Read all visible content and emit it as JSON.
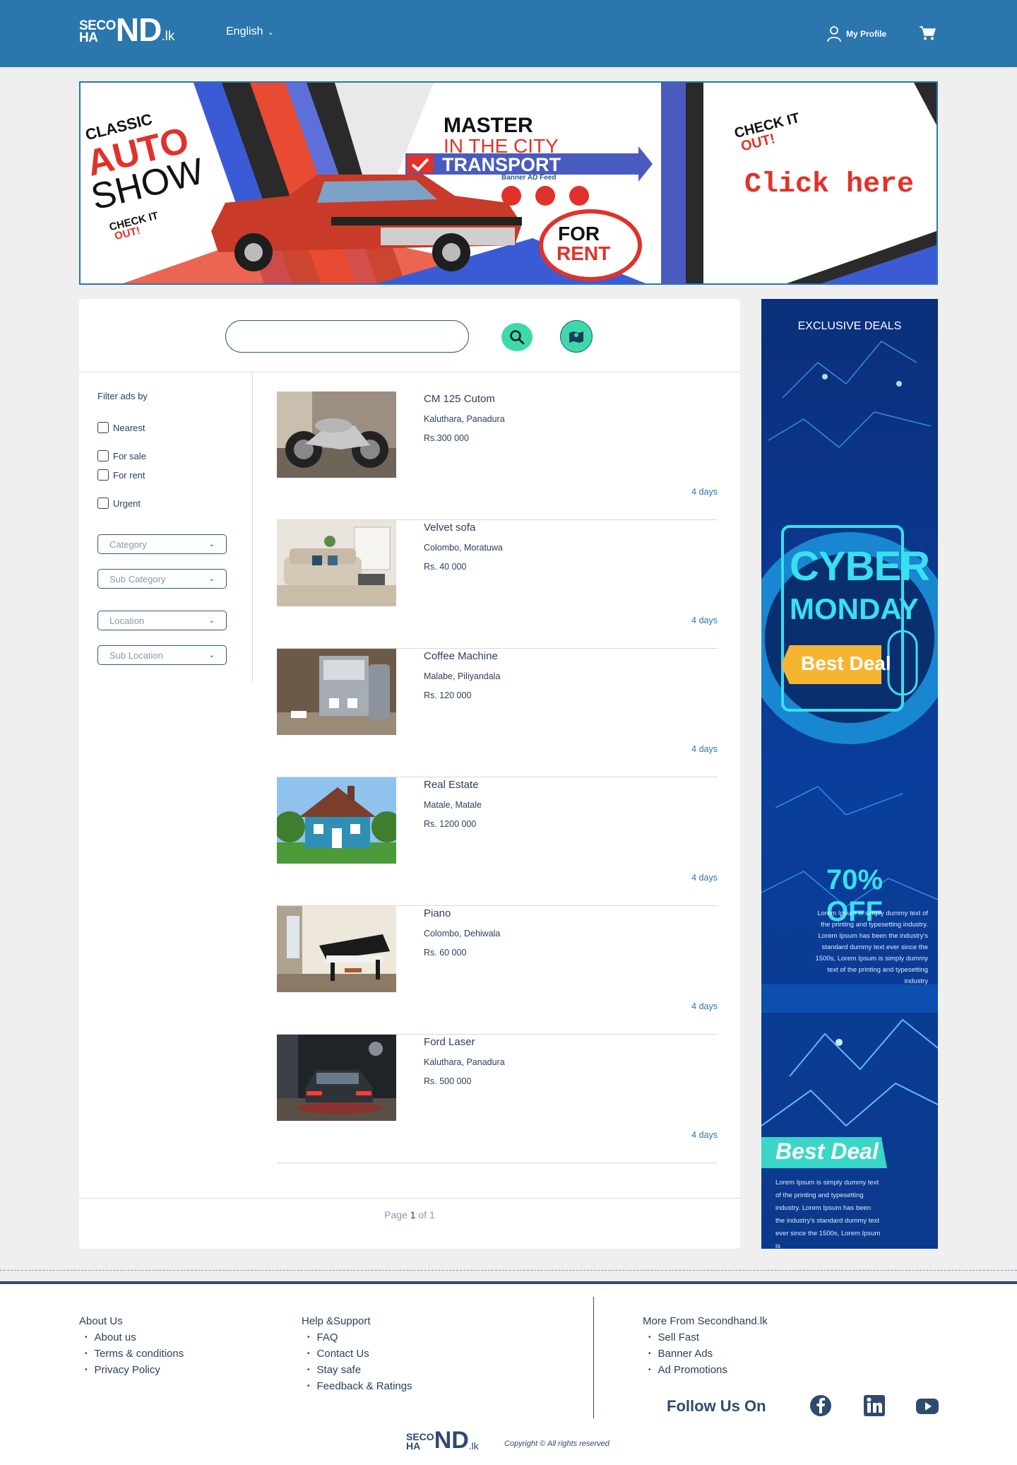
{
  "header": {
    "logo_top": "SECO",
    "logo_bottom": "HA",
    "logo_big": "ND",
    "logo_suffix": ".lk",
    "language": "English",
    "profile_label": "My Profile"
  },
  "top_banner": {
    "show_line1": "CLASSIC",
    "show_line2": "AUTO",
    "show_line3": "SHOW",
    "check_small": "CHECK IT",
    "check_small2": "OUT!",
    "master": "MASTER",
    "city": "IN THE CITY",
    "transport": "TRANSPORT",
    "feed": "Banner AD Feed",
    "for_rent1": "FOR",
    "for_rent2": "RENT",
    "check_big": "CHECK IT",
    "check_big2": "OUT!",
    "click_here": "Click here"
  },
  "filters": {
    "title": "Filter ads by",
    "checkboxes": [
      "Nearest",
      "For sale",
      "For rent",
      "Urgent"
    ],
    "selects": [
      "Category",
      "Sub Category",
      "Location",
      "Sub Location"
    ]
  },
  "listings": [
    {
      "title": "CM 125 Cutom",
      "location": "Kaluthara, Panadura",
      "price": "Rs.300 000",
      "age": "4 days"
    },
    {
      "title": "Velvet sofa",
      "location": "Colombo, Moratuwa",
      "price": "Rs. 40 000",
      "age": "4 days"
    },
    {
      "title": "Coffee Machine",
      "location": "Malabe, Piliyandala",
      "price": "Rs. 120 000",
      "age": "4 days"
    },
    {
      "title": "Real Estate",
      "location": "Matale, Matale",
      "price": "Rs. 1200 000",
      "age": "4 days"
    },
    {
      "title": "Piano",
      "location": "Colombo, Dehiwala",
      "price": "Rs. 60 000",
      "age": "4 days"
    },
    {
      "title": "Ford Laser",
      "location": "Kaluthara, Panadura",
      "price": "Rs. 500 000",
      "age": "4 days"
    }
  ],
  "pager": {
    "prefix": "Page",
    "current": "1",
    "of": "of",
    "total": "1"
  },
  "side_banner": {
    "exclusive": "EXCLUSIVE DEALS",
    "cyber": "CYBER",
    "monday": "MONDAY",
    "best_deal": "Best Deal",
    "off": "70% OFF",
    "lorem1": "Lorem Ipsum is simply dummy text of the printing and typesetting industry. Lorem Ipsum has been the industry's standard dummy text ever since the 1500s, Lorem Ipsum is simply dummy text of the printing and typesetting industry",
    "best_deal2": "Best Deal",
    "lorem2": "Lorem Ipsum is simply dummy text of the printing and typesetting industry. Lorem Ipsum has been the industry's standard dummy text ever since the 1500s, Lorem Ipsum is"
  },
  "footer": {
    "col1": {
      "title": "About Us",
      "links": [
        "About us",
        "Terms & conditions",
        "Privacy Policy"
      ]
    },
    "col2": {
      "title": "Help &Support",
      "links": [
        "FAQ",
        "Contact Us",
        "Stay safe",
        "Feedback & Ratings"
      ]
    },
    "col3": {
      "title": "More From Secondhand.lk",
      "links": [
        "Sell Fast",
        "Banner Ads",
        "Ad Promotions"
      ]
    },
    "follow": "Follow Us On",
    "copyright": "Copyright © All rights reserved"
  },
  "icons": [
    "user-icon",
    "cart-icon",
    "search-icon",
    "map-icon",
    "facebook-icon",
    "linkedin-icon",
    "youtube-icon"
  ],
  "colors": {
    "header": "#2b76ac",
    "accent": "#3ed9a9",
    "text": "#2a3f5e",
    "banner_blue": "#0b3a8c"
  }
}
